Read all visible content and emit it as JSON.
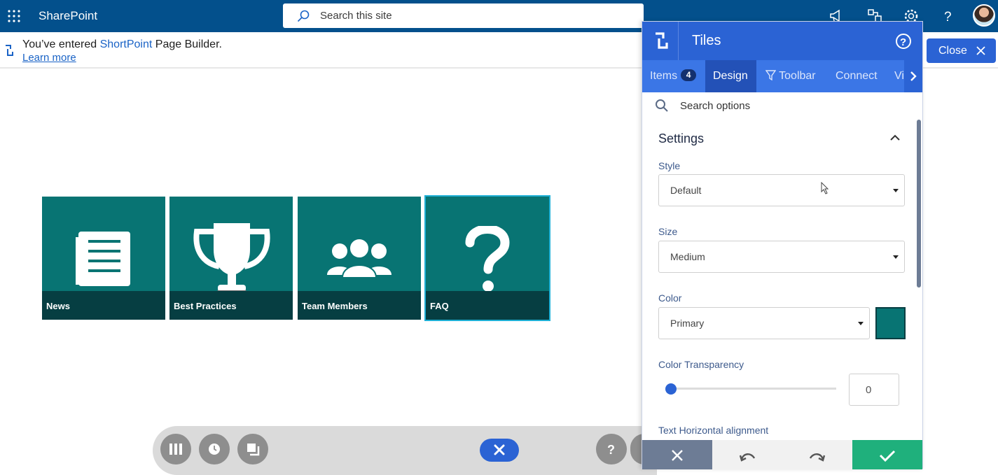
{
  "topbar": {
    "brand": "SharePoint",
    "search_placeholder": "Search this site",
    "icons": [
      "waffle-icon",
      "megaphone-icon",
      "share-icon",
      "gear-icon",
      "help-icon"
    ]
  },
  "notice": {
    "prefix": "You’ve entered ",
    "accent": "ShortPoint",
    "suffix": " Page Builder.",
    "learn_more": "Learn more"
  },
  "tiles": [
    {
      "label": "News",
      "icon": "newspaper-icon"
    },
    {
      "label": "Best Practices",
      "icon": "trophy-icon"
    },
    {
      "label": "Team Members",
      "icon": "team-icon"
    },
    {
      "label": "FAQ",
      "icon": "question-icon"
    }
  ],
  "close_button": "Close",
  "panel": {
    "title": "Tiles",
    "tabs": {
      "items": "Items",
      "items_count": "4",
      "design": "Design",
      "toolbar": "Toolbar",
      "connect": "Connect",
      "vi": "Vi"
    },
    "search_options": "Search options",
    "section": "Settings",
    "style_label": "Style",
    "style_value": "Default",
    "size_label": "Size",
    "size_value": "Medium",
    "color_label": "Color",
    "color_value": "Primary",
    "transparency_label": "Color Transparency",
    "transparency_value": "0",
    "text_halign_label": "Text Horizontal alignment"
  },
  "colors": {
    "tile": "#087473",
    "tile_caption": "#063e42",
    "accent": "#2b63d4",
    "topbar": "#03508c",
    "save": "#1fb07c"
  }
}
